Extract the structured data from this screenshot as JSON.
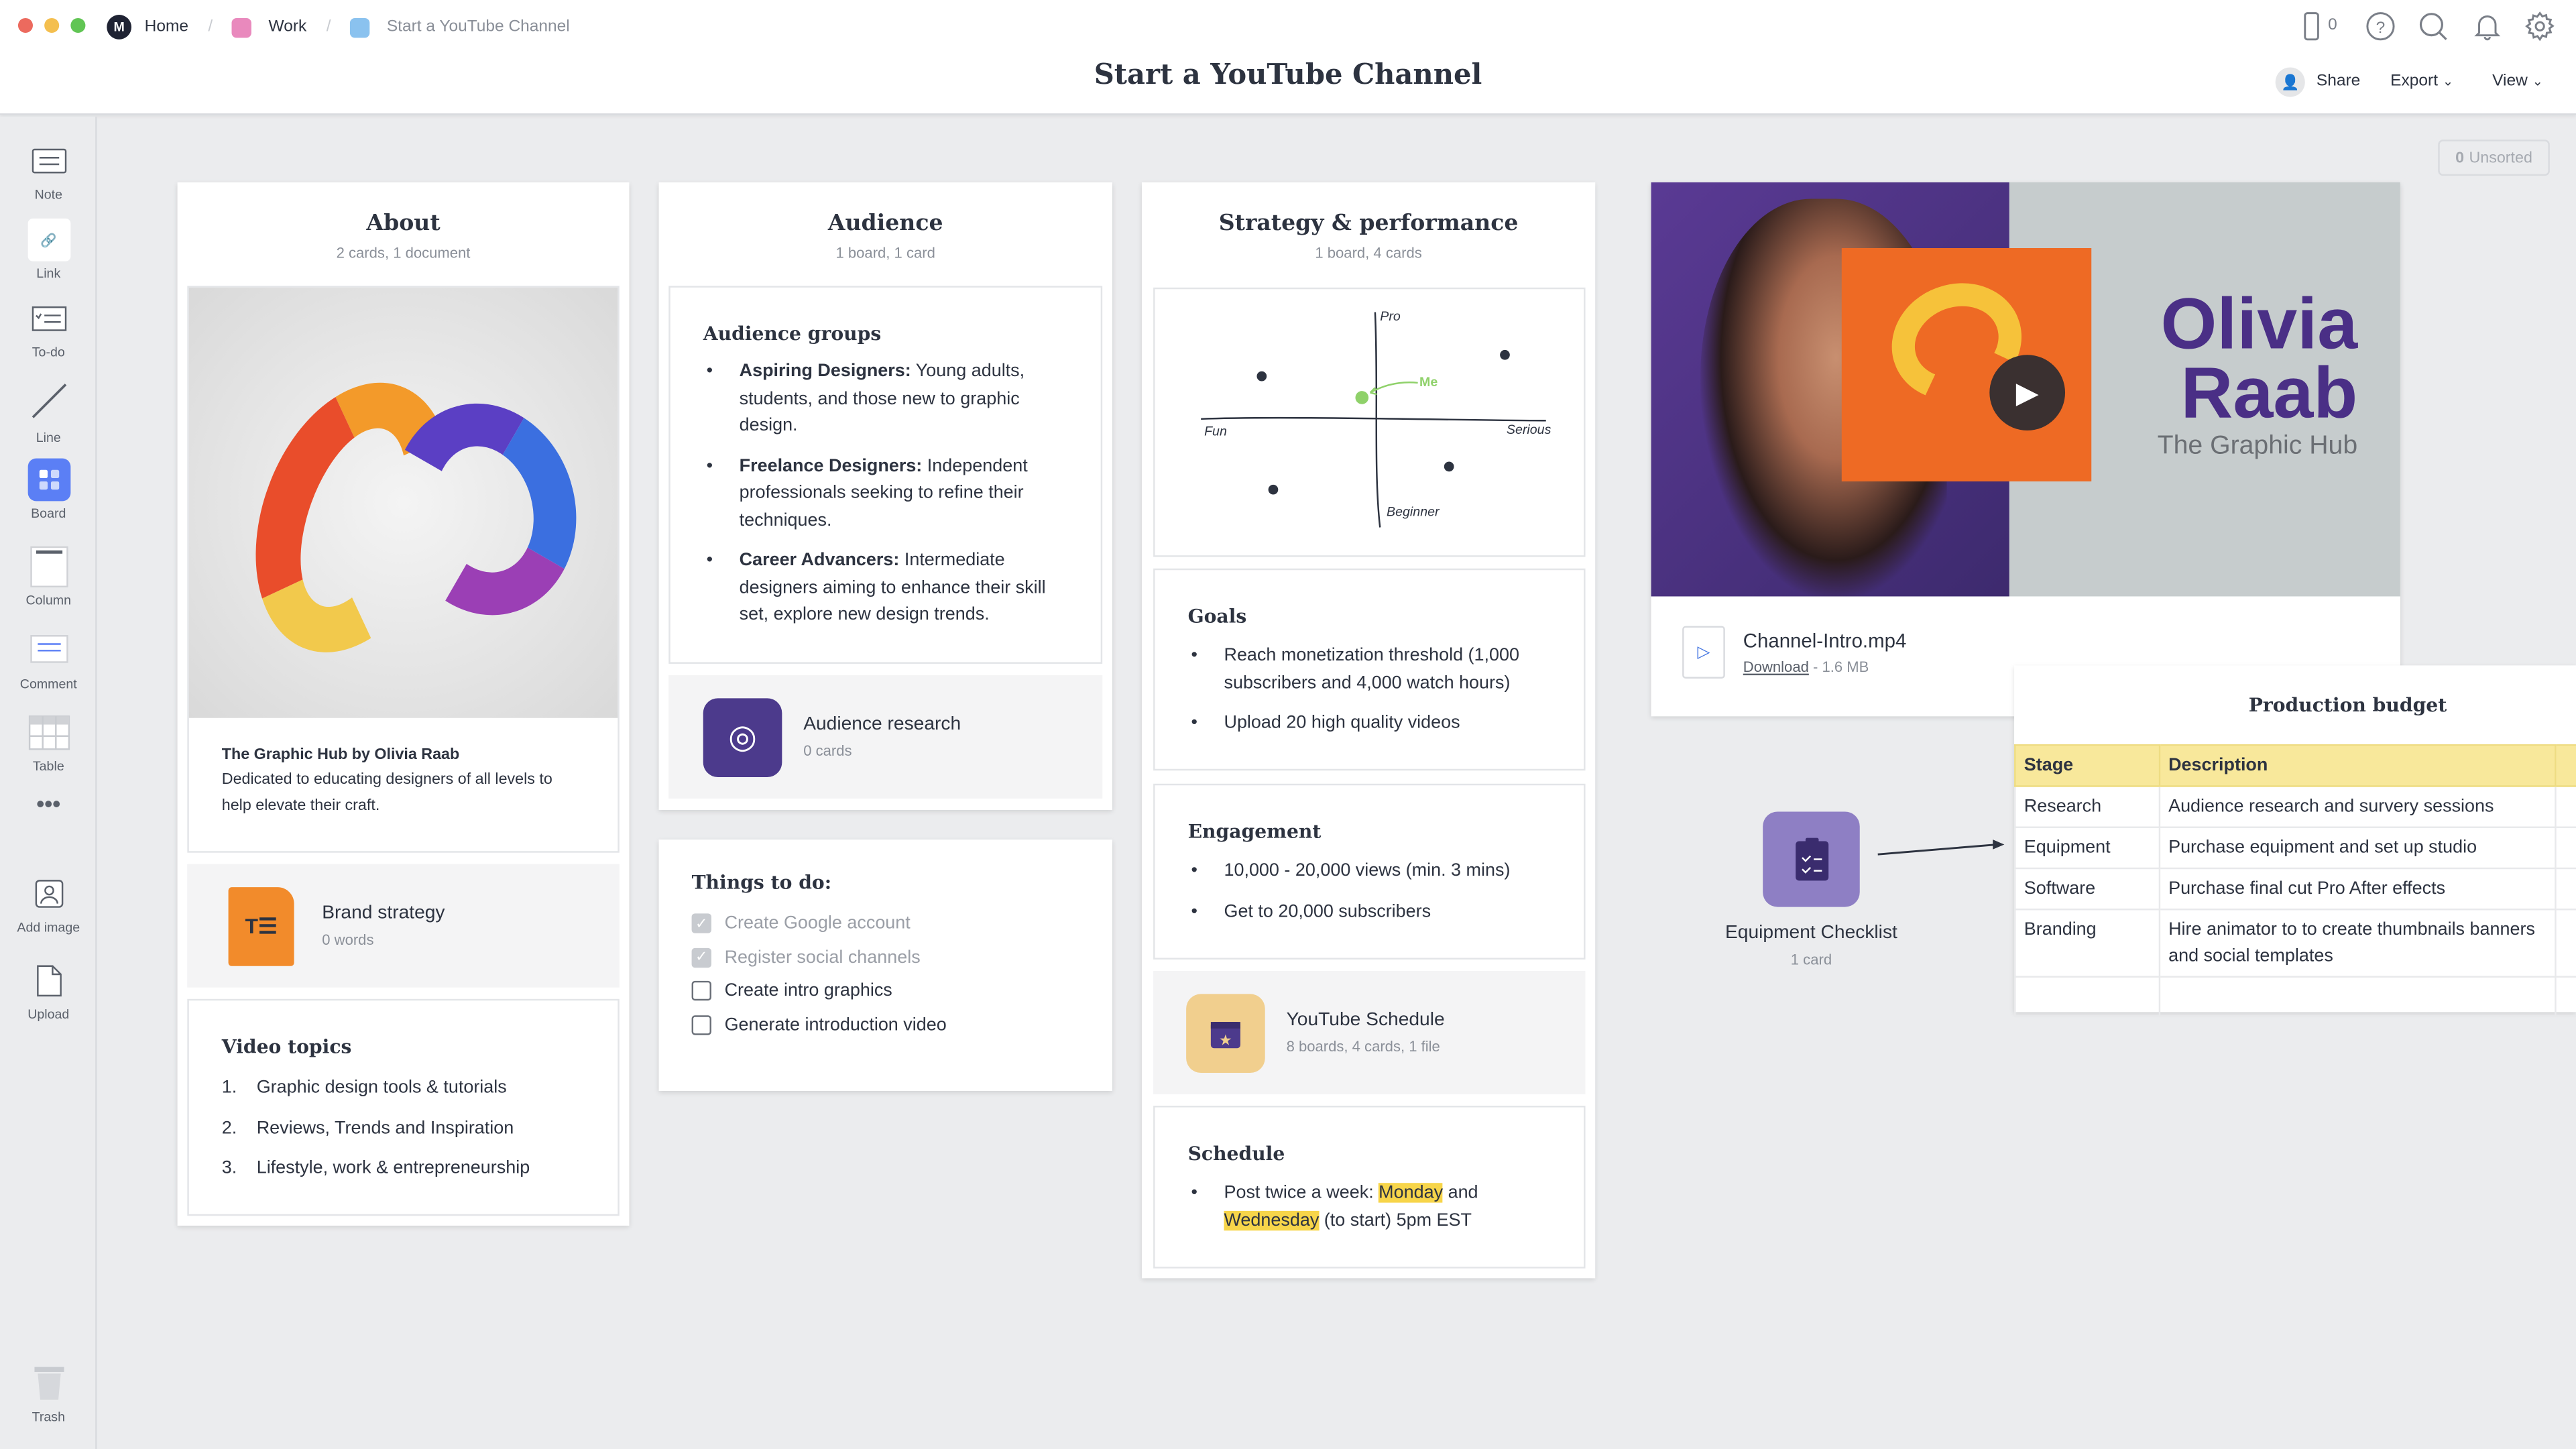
{
  "window": {
    "controls": [
      "close",
      "minimize",
      "maximize"
    ]
  },
  "breadcrumb": [
    {
      "label": "Home",
      "color": "#1f2333"
    },
    {
      "label": "Work",
      "color": "#e989bd"
    },
    {
      "label": "Start a YouTube Channel",
      "color": "#8ac2ef"
    }
  ],
  "header": {
    "title": "Start a YouTube Channel",
    "device_count": "0",
    "share": "Share",
    "export": "Export",
    "view": "View"
  },
  "unsorted": {
    "count": "0",
    "label": "Unsorted"
  },
  "sidebar": {
    "items": [
      {
        "label": "Note",
        "icon": "note-icon"
      },
      {
        "label": "Link",
        "icon": "link-icon"
      },
      {
        "label": "To-do",
        "icon": "todo-icon"
      },
      {
        "label": "Line",
        "icon": "line-icon"
      },
      {
        "label": "Board",
        "icon": "board-icon"
      },
      {
        "label": "Column",
        "icon": "column-icon"
      },
      {
        "label": "Comment",
        "icon": "comment-icon"
      },
      {
        "label": "Table",
        "icon": "table-icon"
      },
      {
        "label": "",
        "icon": "more-icon"
      },
      {
        "label": "Add image",
        "icon": "add-image-icon"
      },
      {
        "label": "Upload",
        "icon": "upload-icon"
      }
    ],
    "trash": "Trash"
  },
  "about": {
    "title": "About",
    "subtitle": "2 cards, 1 document",
    "image_caption_title": "The Graphic Hub by Olivia Raab",
    "image_caption_text": "Dedicated to educating designers of all levels to help elevate their craft.",
    "doc": {
      "title": "Brand strategy",
      "meta": "0 words"
    },
    "video_topics": {
      "title": "Video topics",
      "items": [
        "Graphic design tools & tutorials",
        "Reviews, Trends and Inspiration",
        "Lifestyle, work & entrepreneurship"
      ]
    }
  },
  "audience": {
    "title": "Audience",
    "subtitle": "1 board, 1 card",
    "groups_title": "Audience groups",
    "groups": [
      {
        "name": "Aspiring Designers:",
        "text": " Young adults, students, and those new to graphic design."
      },
      {
        "name": "Freelance Designers:",
        "text": " Independent professionals seeking to refine their techniques."
      },
      {
        "name": "Career Advancers:",
        "text": " Intermediate designers aiming to enhance their skill set, explore new design trends."
      }
    ],
    "research": {
      "title": "Audience research",
      "meta": "0 cards"
    },
    "todo": {
      "title": "Things to do:",
      "items": [
        {
          "label": "Create Google account",
          "done": true
        },
        {
          "label": "Register social channels",
          "done": true
        },
        {
          "label": "Create intro graphics",
          "done": false
        },
        {
          "label": "Generate introduction video",
          "done": false
        }
      ]
    }
  },
  "strategy": {
    "title": "Strategy & performance",
    "subtitle": "1 board, 4 cards",
    "sketch": {
      "top": "Pro",
      "bottom": "Beginner",
      "left": "Fun",
      "right": "Serious",
      "me": "Me",
      "me_color": "#8fd16a"
    },
    "goals": {
      "title": "Goals",
      "items": [
        "Reach monetization threshold (1,000 subscribers and 4,000 watch hours)",
        "Upload 20 high quality videos"
      ]
    },
    "engagement": {
      "title": "Engagement",
      "items": [
        "10,000 - 20,000 views (min. 3 mins)",
        "Get to 20,000 subscribers"
      ]
    },
    "schedule_board": {
      "title": "YouTube Schedule",
      "meta": "8 boards, 4 cards, 1 file"
    },
    "schedule": {
      "title": "Schedule",
      "pre": "Post twice a week: ",
      "day1": "Monday",
      "mid": " and ",
      "day2": "Wednesday",
      "post": " (to start) 5pm EST"
    }
  },
  "video": {
    "brand_name_1": "Olivia",
    "brand_name_2": "Raab",
    "brand_sub": "The Graphic Hub",
    "file_name": "Channel-Intro.mp4",
    "download": "Download",
    "size": " - 1.6 MB"
  },
  "checklist": {
    "title": "Equipment Checklist",
    "meta": "1 card"
  },
  "budget": {
    "title": "Production budget",
    "columns": [
      "Stage",
      "Description"
    ],
    "rows": [
      [
        "Research",
        "Audience research and survery sessions"
      ],
      [
        "Equipment",
        "Purchase equipment and set up studio"
      ],
      [
        "Software",
        "Purchase final cut Pro After effects"
      ],
      [
        "Branding",
        "Hire animator to to create thumbnails banners and social templates"
      ]
    ]
  }
}
